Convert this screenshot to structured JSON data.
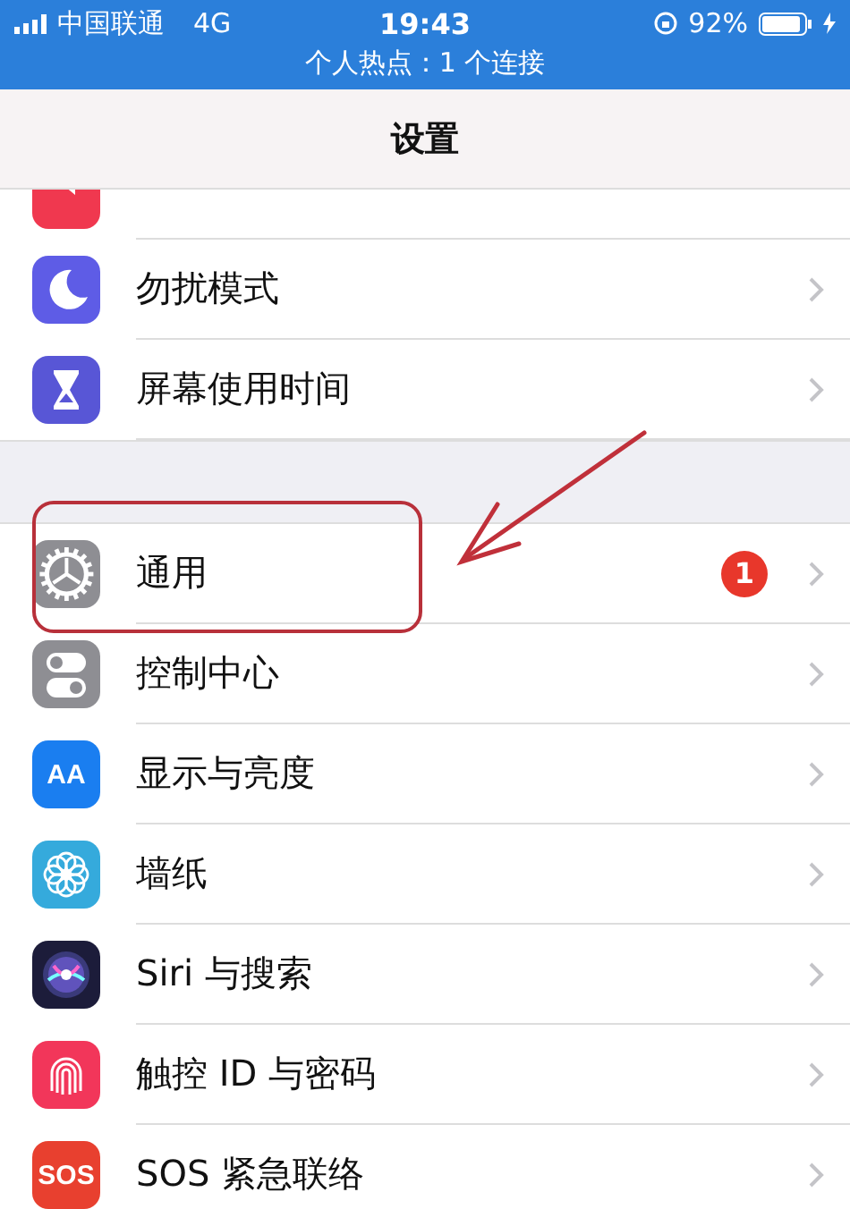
{
  "status_bar": {
    "carrier": "中国联通",
    "network": "4G",
    "time": "19:43",
    "battery": "92%"
  },
  "hotspot_banner": "个人热点：1 个连接",
  "nav": {
    "title": "设置"
  },
  "top_peek": {
    "kind": "sound"
  },
  "groups": [
    {
      "rows": [
        {
          "kind": "moon",
          "label": "勿扰模式"
        },
        {
          "kind": "hourglass",
          "label": "屏幕使用时间"
        }
      ]
    },
    {
      "rows": [
        {
          "kind": "gear",
          "label": "通用",
          "badge": "1",
          "highlighted": true
        },
        {
          "kind": "toggles",
          "label": "控制中心"
        },
        {
          "kind": "display",
          "icon_text": "AA",
          "label": "显示与亮度"
        },
        {
          "kind": "flower",
          "label": "墙纸"
        },
        {
          "kind": "siri",
          "label": "Siri 与搜索"
        },
        {
          "kind": "fingerprint",
          "label": "触控 ID 与密码"
        },
        {
          "kind": "sos",
          "icon_text": "SOS",
          "label": "SOS 紧急联络"
        }
      ]
    }
  ],
  "annotation": {
    "kind": "arrow"
  }
}
